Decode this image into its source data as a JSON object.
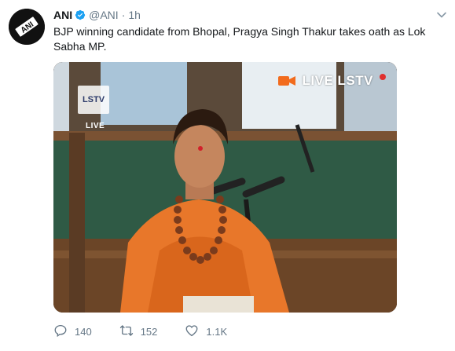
{
  "tweet": {
    "author_name": "ANI",
    "author_handle": "@ANI",
    "separator": "·",
    "timestamp": "1h",
    "avatar_text": "ANI",
    "text": "BJP winning candidate from Bhopal, Pragya Singh Thakur takes oath as Lok Sabha MP."
  },
  "media": {
    "watermark_text": "LSTV",
    "live_small": "LIVE",
    "live_badge": "LIVE LSTV"
  },
  "actions": {
    "replies": "140",
    "retweets": "152",
    "likes": "1.1K"
  },
  "colors": {
    "verified": "#1da1f2",
    "muted": "#657786",
    "saffron": "#e8772a"
  }
}
